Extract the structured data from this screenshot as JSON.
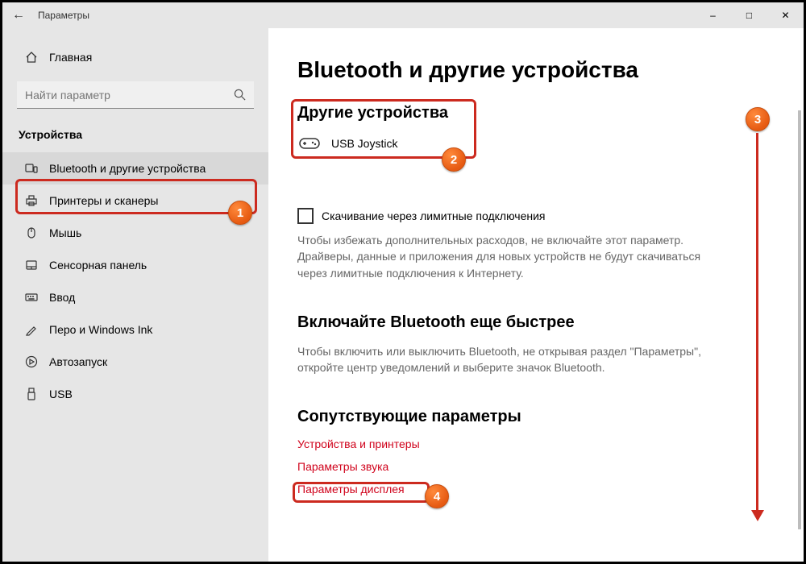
{
  "titlebar": {
    "back": "←",
    "title": "Параметры"
  },
  "sidebar": {
    "home": "Главная",
    "search_placeholder": "Найти параметр",
    "group": "Устройства",
    "items": [
      {
        "label": "Bluetooth и другие устройства",
        "selected": true
      },
      {
        "label": "Принтеры и сканеры"
      },
      {
        "label": "Мышь"
      },
      {
        "label": "Сенсорная панель"
      },
      {
        "label": "Ввод"
      },
      {
        "label": "Перо и Windows Ink"
      },
      {
        "label": "Автозапуск"
      },
      {
        "label": "USB"
      }
    ]
  },
  "main": {
    "page_title": "Bluetooth и другие устройства",
    "other_devices_heading": "Другие устройства",
    "device_name": "USB  Joystick",
    "metered_checkbox": "Скачивание через лимитные подключения",
    "metered_help": "Чтобы избежать дополнительных расходов, не включайте этот параметр. Драйверы, данные и приложения для новых устройств не будут скачиваться через лимитные подключения к Интернету.",
    "faster_heading": "Включайте Bluetooth еще быстрее",
    "faster_help": "Чтобы включить или выключить Bluetooth, не открывая раздел \"Параметры\", откройте центр уведомлений и выберите значок Bluetooth.",
    "related_heading": "Сопутствующие параметры",
    "links": [
      "Устройства и принтеры",
      "Параметры звука",
      "Параметры дисплея"
    ]
  },
  "annotations": {
    "b1": "1",
    "b2": "2",
    "b3": "3",
    "b4": "4"
  }
}
